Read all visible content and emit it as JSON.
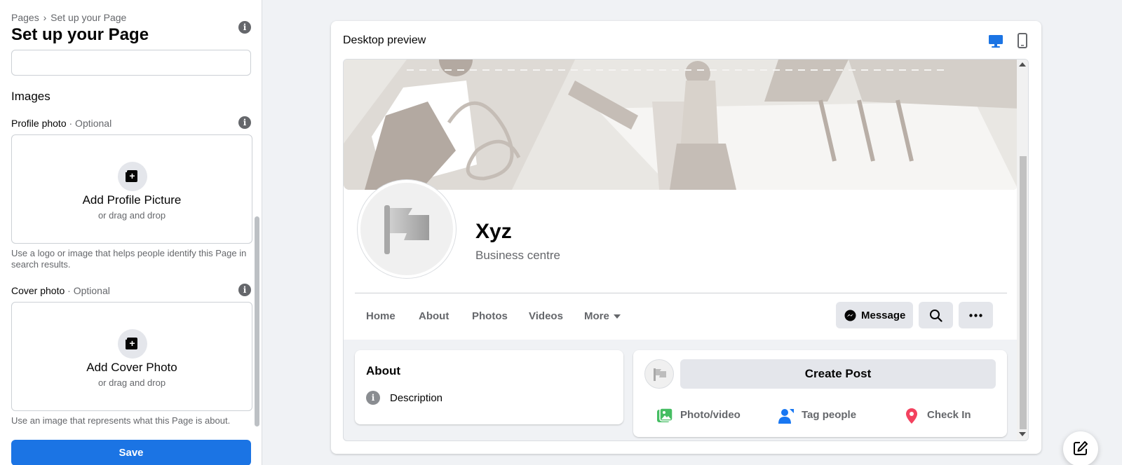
{
  "sidebar": {
    "breadcrumb": {
      "parent": "Pages",
      "separator": "›",
      "current": "Set up your Page"
    },
    "title": "Set up your Page",
    "name_input": {
      "value": ""
    },
    "images_heading": "Images",
    "profile_photo": {
      "label": "Profile photo",
      "optional": "· Optional",
      "add_title": "Add Profile Picture",
      "add_sub": "or drag and drop",
      "help": "Use a logo or image that helps people identify this Page in search results."
    },
    "cover_photo": {
      "label": "Cover photo",
      "optional": "· Optional",
      "add_title": "Add Cover Photo",
      "add_sub": "or drag and drop",
      "help": "Use an image that represents what this Page is about."
    },
    "save_label": "Save"
  },
  "preview": {
    "title": "Desktop preview",
    "devices": [
      "desktop-icon",
      "mobile-icon"
    ],
    "active_device": "desktop",
    "page": {
      "name": "Xyz",
      "category": "Business centre",
      "tabs": [
        "Home",
        "About",
        "Photos",
        "Videos",
        "More"
      ],
      "message_label": "Message",
      "about_title": "About",
      "about_description": "Description",
      "create_post_label": "Create Post",
      "post_actions": [
        "Photo/video",
        "Tag people",
        "Check In"
      ]
    }
  },
  "colors": {
    "primary": "#1b74e4",
    "background": "#f0f2f5",
    "secondary_text": "#65676b",
    "button_gray": "#e4e6eb",
    "photo_green": "#45bd62",
    "tag_blue": "#1877f2",
    "checkin_red": "#f3425f"
  }
}
